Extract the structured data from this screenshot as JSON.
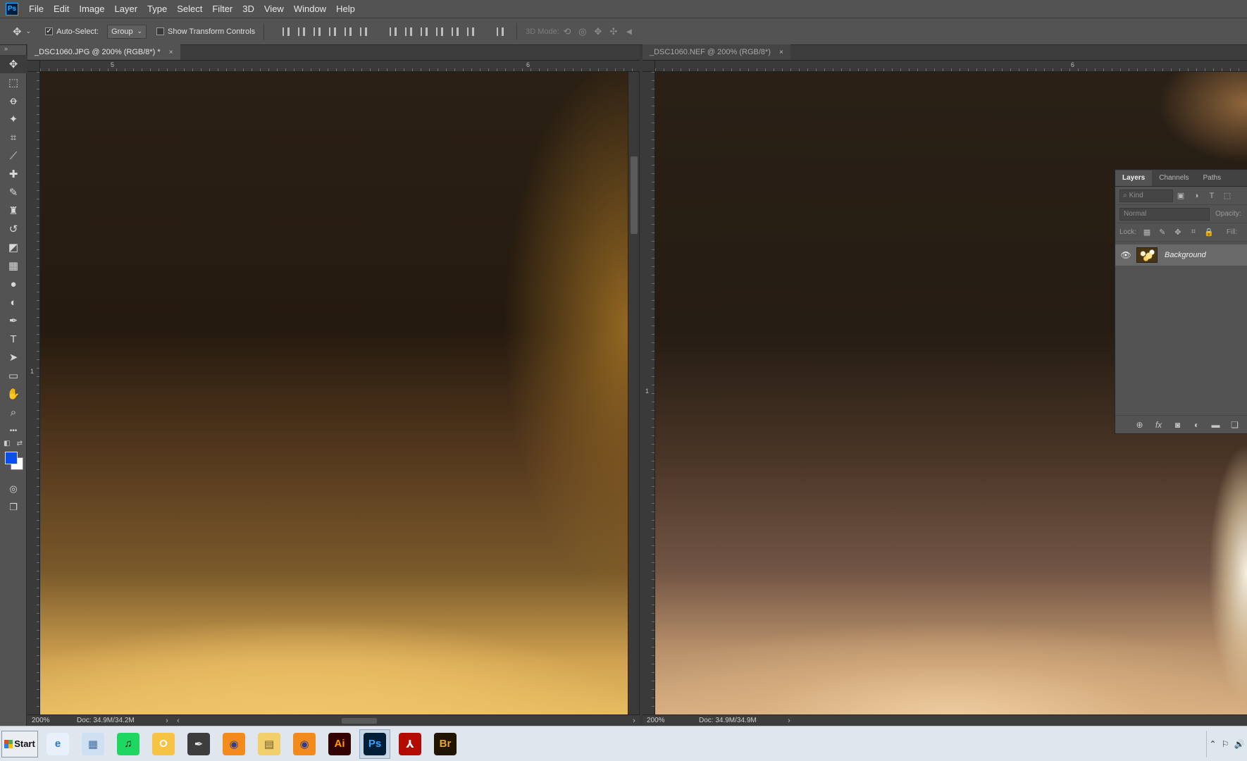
{
  "app": {
    "logo": "Ps"
  },
  "menu": [
    "File",
    "Edit",
    "Image",
    "Layer",
    "Type",
    "Select",
    "Filter",
    "3D",
    "View",
    "Window",
    "Help"
  ],
  "options": {
    "move_icon": "✥",
    "auto_select_label": "Auto-Select:",
    "auto_select_checked": "✓",
    "group_value": "Group",
    "show_transform_label": "Show Transform Controls",
    "mode3d_label": "3D Mode:",
    "icons3d": [
      "⟲",
      "◎",
      "✥",
      "✣",
      "◄"
    ]
  },
  "toolbar": {
    "handle": "»",
    "tools": [
      {
        "name": "move-tool",
        "glyph": "✥"
      },
      {
        "name": "marquee-tool",
        "glyph": "⬚"
      },
      {
        "name": "lasso-tool",
        "glyph": "ꝋ"
      },
      {
        "name": "magic-wand-tool",
        "glyph": "✦"
      },
      {
        "name": "crop-tool",
        "glyph": "⌗"
      },
      {
        "name": "eyedropper-tool",
        "glyph": "⟋"
      },
      {
        "name": "healing-brush-tool",
        "glyph": "✚"
      },
      {
        "name": "brush-tool",
        "glyph": "✎"
      },
      {
        "name": "clone-stamp-tool",
        "glyph": "♜"
      },
      {
        "name": "history-brush-tool",
        "glyph": "↺"
      },
      {
        "name": "eraser-tool",
        "glyph": "◩"
      },
      {
        "name": "gradient-tool",
        "glyph": "▦"
      },
      {
        "name": "blur-tool",
        "glyph": "●"
      },
      {
        "name": "dodge-tool",
        "glyph": "◐"
      },
      {
        "name": "pen-tool",
        "glyph": "✒"
      },
      {
        "name": "type-tool",
        "glyph": "T"
      },
      {
        "name": "path-selection-tool",
        "glyph": "➤"
      },
      {
        "name": "rectangle-tool",
        "glyph": "▭"
      },
      {
        "name": "hand-tool",
        "glyph": "✋"
      },
      {
        "name": "zoom-tool",
        "glyph": "⌕"
      },
      {
        "name": "more-tools",
        "glyph": "•••"
      }
    ],
    "swap_icon": "⇄",
    "default_colors_icon": "◧",
    "quick_mask_icon": "◎",
    "screen_mode_icon": "❐",
    "fg_color": "#0a4df2",
    "bg_color": "#ffffff"
  },
  "doc1": {
    "tab": "_DSC1060.JPG @ 200% (RGB/8*) *",
    "close": "×",
    "ruler_h": [
      "5",
      "6"
    ],
    "ruler_v": [
      "1"
    ],
    "zoom": "200%",
    "docinfo": "Doc: 34.9M/34.2M",
    "chev_right": "›",
    "chev_left": "‹"
  },
  "doc2": {
    "tab": "_DSC1060.NEF @ 200% (RGB/8*)",
    "close": "×",
    "ruler_h": [
      "6"
    ],
    "ruler_v": [
      "1"
    ],
    "zoom": "200%",
    "docinfo": "Doc: 34.9M/34.9M",
    "chev_right": "›"
  },
  "layers_panel": {
    "tabs": [
      "Layers",
      "Channels",
      "Paths"
    ],
    "kind_placeholder": "Kind",
    "kind_icon": "⌕",
    "filter_icons": [
      "▣",
      "◑",
      "T",
      "⬚"
    ],
    "blend_mode": "Normal",
    "opacity_label": "Opacity:",
    "lock_label": "Lock:",
    "lock_icons": [
      "▦",
      "✎",
      "✥",
      "⌗",
      "🔒"
    ],
    "fill_label": "Fill:",
    "layer_name": "Background",
    "eye_icon": "👁",
    "footer_icons": [
      "⊕",
      "fx",
      "◙",
      "◐",
      "▬",
      "❏"
    ]
  },
  "taskbar": {
    "start_label": "Start",
    "apps": [
      {
        "name": "internet-explorer",
        "label": "e",
        "bg": "#e7f0fb",
        "fg": "#1e78d7"
      },
      {
        "name": "calculator",
        "label": "▦",
        "bg": "#cfe0f2",
        "fg": "#3c6ea8"
      },
      {
        "name": "spotify",
        "label": "♫",
        "bg": "#1ed760",
        "fg": "#111111"
      },
      {
        "name": "outlook",
        "label": "O",
        "bg": "#f6c344",
        "fg": "#ffffff"
      },
      {
        "name": "pen-app",
        "label": "✒",
        "bg": "#3d3d3d",
        "fg": "#f0f0f0"
      },
      {
        "name": "firefox",
        "label": "◉",
        "bg": "#f28a1c",
        "fg": "#2a3f8f"
      },
      {
        "name": "file-explorer",
        "label": "▤",
        "bg": "#f3cf6b",
        "fg": "#6a5a2a"
      },
      {
        "name": "firefox-2",
        "label": "◉",
        "bg": "#f28a1c",
        "fg": "#2a3f8f"
      },
      {
        "name": "illustrator",
        "label": "Ai",
        "bg": "#330000",
        "fg": "#ff9a00"
      },
      {
        "name": "photoshop",
        "label": "Ps",
        "bg": "#001e36",
        "fg": "#31a8ff"
      },
      {
        "name": "acrobat",
        "label": "⅄",
        "bg": "#b30b00",
        "fg": "#ffffff"
      },
      {
        "name": "bridge",
        "label": "Br",
        "bg": "#1f1500",
        "fg": "#e8a430"
      }
    ],
    "tray": [
      "⌃",
      "⚐",
      "🔊"
    ]
  }
}
